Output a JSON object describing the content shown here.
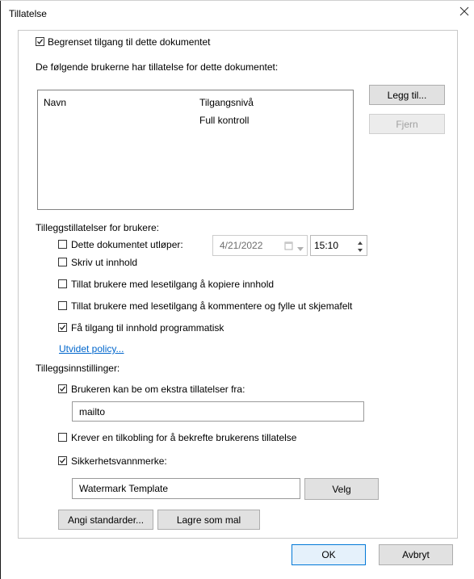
{
  "dialog": {
    "title": "Tillatelse",
    "close_icon": "close-icon"
  },
  "restrict": {
    "label": "Begrenset tilgang til dette dokumentet",
    "checked": true
  },
  "users_heading": "De følgende brukerne har tillatelse for dette dokumentet:",
  "user_list": {
    "columns": [
      "Navn",
      "Tilgangsnivå"
    ],
    "rows": [
      {
        "name": "",
        "level": "Full kontroll"
      }
    ]
  },
  "buttons": {
    "add": "Legg til...",
    "remove": "Fjern",
    "defaults": "Angi standarder...",
    "save_template": "Lagre som mal",
    "choose": "Velg",
    "ok": "OK",
    "cancel": "Avbryt"
  },
  "extra_permissions": {
    "heading": "Tilleggstillatelser for brukere:",
    "expires": {
      "label": "Dette dokumentet utløper:",
      "checked": false,
      "date": "4/21/2022",
      "time": "15:10"
    },
    "print": {
      "label": "Skriv ut innhold",
      "checked": false
    },
    "copy": {
      "label": "Tillat brukere med lesetilgang å kopiere innhold",
      "checked": false
    },
    "comment": {
      "label": "Tillat brukere med lesetilgang å kommentere og fylle ut skjemafelt",
      "checked": false
    },
    "programmatic": {
      "label": "Få tilgang til innhold programmatisk",
      "checked": true
    },
    "policy_link": "Utvidet policy..."
  },
  "extra_settings": {
    "heading": "Tilleggsinnstillinger:",
    "request": {
      "label": "Brukeren kan be om ekstra tillatelser fra:",
      "checked": true,
      "value": "mailto"
    },
    "connection": {
      "label": "Krever en tilkobling for å bekrefte brukerens tillatelse",
      "checked": false
    },
    "watermark": {
      "label": "Sikkerhetsvannmerke:",
      "checked": true,
      "value": "Watermark Template"
    }
  }
}
